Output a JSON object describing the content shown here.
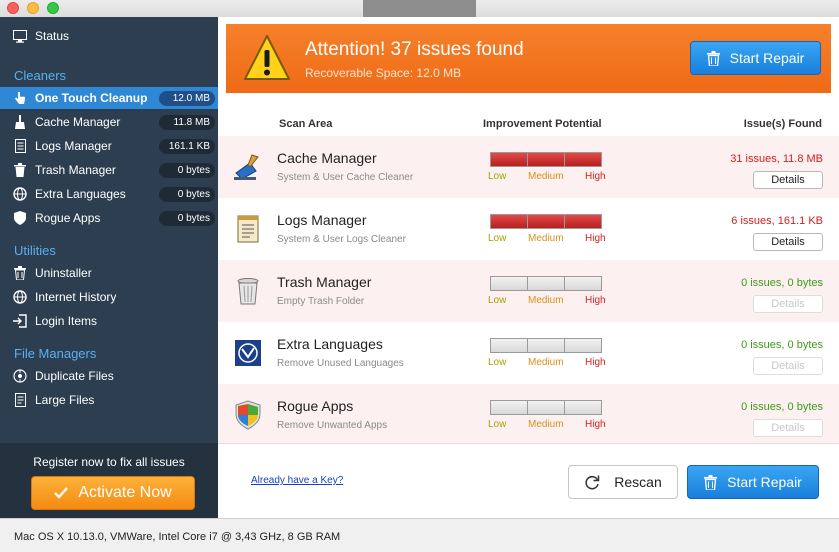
{
  "sidebar": {
    "status_label": "Status",
    "cleaners_header": "Cleaners",
    "cleaners": [
      {
        "label": "One Touch Cleanup",
        "value": "12.0 MB",
        "icon": "hand-pointer-icon",
        "active": true
      },
      {
        "label": "Cache Manager",
        "value": "11.8 MB",
        "icon": "broom-icon"
      },
      {
        "label": "Logs Manager",
        "value": "161.1 KB",
        "icon": "document-icon"
      },
      {
        "label": "Trash Manager",
        "value": "0 bytes",
        "icon": "trash-icon"
      },
      {
        "label": "Extra Languages",
        "value": "0 bytes",
        "icon": "globe-icon"
      },
      {
        "label": "Rogue Apps",
        "value": "0 bytes",
        "icon": "shield-icon"
      }
    ],
    "utilities_header": "Utilities",
    "utilities": [
      {
        "label": "Uninstaller",
        "icon": "trash-icon"
      },
      {
        "label": "Internet History",
        "icon": "globe-icon"
      },
      {
        "label": "Login Items",
        "icon": "login-icon"
      }
    ],
    "file_managers_header": "File Managers",
    "file_managers": [
      {
        "label": "Duplicate Files",
        "icon": "duplicate-icon"
      },
      {
        "label": "Large Files",
        "icon": "file-icon"
      }
    ],
    "register_text": "Register now to fix all issues",
    "activate_label": "Activate Now"
  },
  "banner": {
    "title": "Attention! 37 issues found",
    "subtitle": "Recoverable Space: 12.0 MB",
    "button_label": "Start Repair"
  },
  "table": {
    "col_scan_area": "Scan Area",
    "col_improvement": "Improvement Potential",
    "col_issues": "Issue(s) Found",
    "scale_low": "Low",
    "scale_medium": "Medium",
    "scale_high": "High",
    "details_label": "Details",
    "rows": [
      {
        "name": "Cache Manager",
        "desc": "System & User Cache Cleaner",
        "found": "31 issues, 11.8 MB",
        "level": "high",
        "found_color": "#d01e1e",
        "details_enabled": true,
        "icon": "cache-icon"
      },
      {
        "name": "Logs Manager",
        "desc": "System & User Logs Cleaner",
        "found": "6 issues, 161.1 KB",
        "level": "high",
        "found_color": "#d01e1e",
        "details_enabled": true,
        "icon": "logs-icon"
      },
      {
        "name": "Trash Manager",
        "desc": "Empty Trash Folder",
        "found": "0 issues, 0 bytes",
        "level": "none",
        "found_color": "#3f9a1c",
        "details_enabled": false,
        "icon": "trash-can-icon"
      },
      {
        "name": "Extra Languages",
        "desc": "Remove Unused Languages",
        "found": "0 issues, 0 bytes",
        "level": "none",
        "found_color": "#3f9a1c",
        "details_enabled": false,
        "icon": "languages-icon"
      },
      {
        "name": "Rogue Apps",
        "desc": "Remove Unwanted Apps",
        "found": "0 issues, 0 bytes",
        "level": "none",
        "found_color": "#3f9a1c",
        "details_enabled": false,
        "icon": "rogue-shield-icon"
      }
    ]
  },
  "footer": {
    "key_link": "Already have a Key?",
    "rescan_label": "Rescan",
    "repair_label": "Start Repair"
  },
  "status_bar": "Mac OS X 10.13.0, VMWare, Intel Core i7 @ 3,43 GHz, 8 GB RAM",
  "colors": {
    "accent_blue": "#2f88d6",
    "banner_orange": "#f47a22",
    "sidebar_bg": "#2c3e50",
    "issue_red": "#d01e1e",
    "ok_green": "#3f9a1c"
  }
}
